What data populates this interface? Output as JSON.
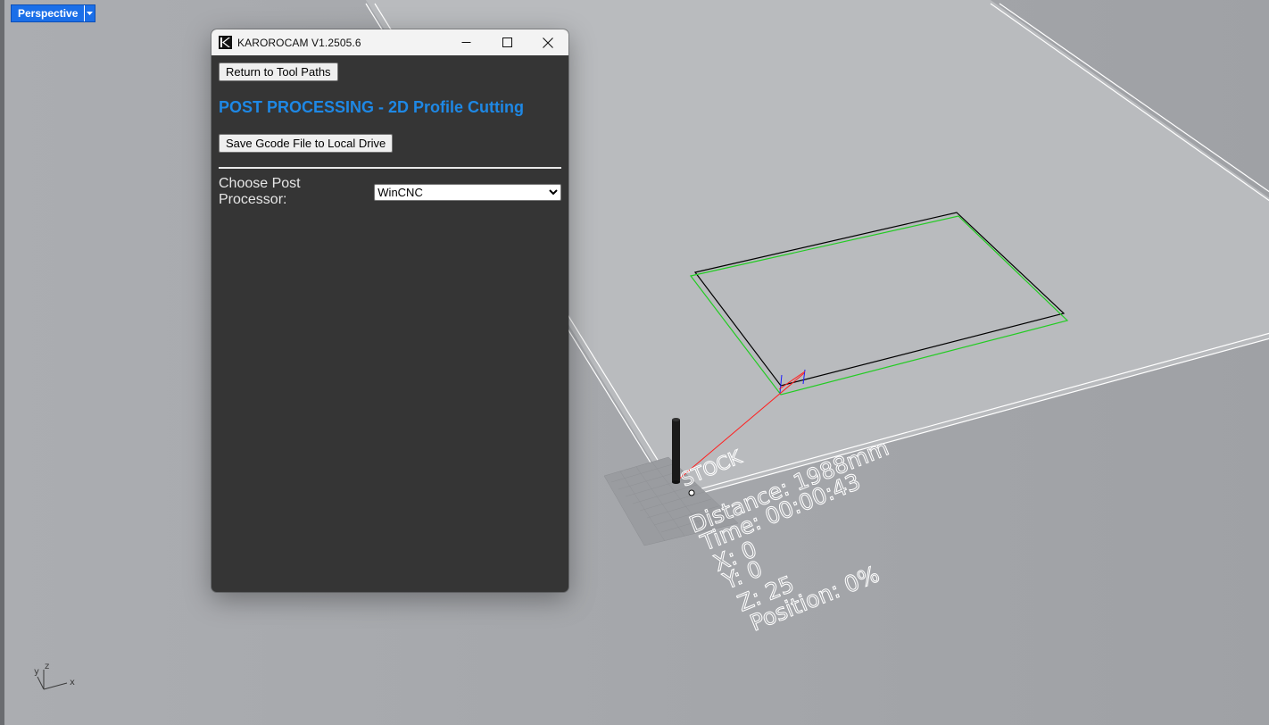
{
  "viewport": {
    "name": "Perspective",
    "dropdown_icon": "chevron-down-icon",
    "stock_label": "STOCK",
    "readout": {
      "distance": "Distance: 1988mm",
      "time": "Time: 00:00:43",
      "x": "X: 0",
      "y": "Y: 0",
      "z": "Z: 25",
      "position": "Position: 0%"
    },
    "axis_labels": {
      "x": "x",
      "y": "y",
      "z": "z"
    },
    "colors": {
      "background": "#a9abaf",
      "toolpath": "#22cc22",
      "rapid": "#ff2020",
      "bed_edge": "#ffffff"
    }
  },
  "window": {
    "title": "KAROROCAM  V1.2505.6",
    "logo_icon": "karorocam-logo-icon",
    "controls": {
      "minimize": "minimize-icon",
      "maximize": "maximize-icon",
      "close": "close-icon"
    },
    "return_button": "Return to Tool Paths",
    "heading": "POST PROCESSING - 2D Profile Cutting",
    "save_button": "Save Gcode File to Local Drive",
    "post_processor": {
      "label": "Choose Post Processor:",
      "selected": "WinCNC"
    },
    "colors": {
      "background": "#353535",
      "heading": "#1e88e5"
    }
  }
}
